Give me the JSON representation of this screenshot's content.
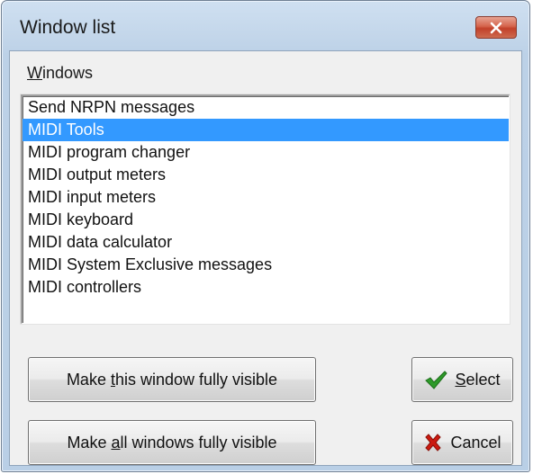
{
  "window": {
    "title": "Window list",
    "close_icon": "close-icon",
    "close_color": "#c7432b"
  },
  "group": {
    "label_underlined": "W",
    "label_rest": "indows"
  },
  "list": {
    "selected_index": 1,
    "selection_color": "#3399ff",
    "items": [
      "Send NRPN messages",
      "MIDI Tools",
      "MIDI program changer",
      "MIDI output meters",
      "MIDI input meters",
      "MIDI keyboard",
      "MIDI data calculator",
      "MIDI System Exclusive messages",
      "MIDI controllers"
    ]
  },
  "buttons": {
    "make_visible": {
      "pre": "Make ",
      "underlined": "t",
      "post": "his window fully visible"
    },
    "make_all_visible": {
      "pre": "Make ",
      "underlined": "a",
      "post": "ll windows fully visible"
    },
    "select": {
      "pre": "",
      "underlined": "S",
      "post": "elect",
      "icon": "checkmark-icon",
      "icon_color": "#2e9a2a"
    },
    "cancel": {
      "label": "Cancel",
      "icon": "red-x-icon",
      "icon_color": "#cc1a10"
    }
  }
}
